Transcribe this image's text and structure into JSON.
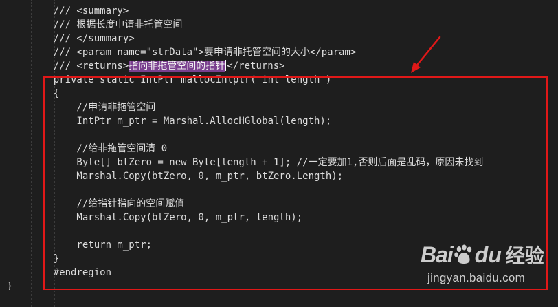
{
  "code": {
    "lines": [
      "    /// <summary>",
      "    /// 根据长度申请非托管空间",
      "    /// </summary>",
      "    /// <param name=\"strData\">要申请非托管空间的大小</param>",
      "    /// <returns>",
      "    private static IntPtr mallocIntptr( int length )",
      "    {",
      "        //申请非拖管空间",
      "        IntPtr m_ptr = Marshal.AllocHGlobal(length);",
      "",
      "        //给非拖管空间清 0",
      "        Byte[] btZero = new Byte[length + 1]; //一定要加1,否则后面是乱码，原因未找到",
      "        Marshal.Copy(btZero, 0, m_ptr, btZero.Length);",
      "",
      "        //给指针指向的空间赋值",
      "        Marshal.Copy(btZero, 0, m_ptr, length);",
      "",
      "        return m_ptr;",
      "    }",
      "    #endregion",
      "}"
    ],
    "selected_text": "指向非拖管空间的指针",
    "returns_close_tag": "</returns>"
  },
  "watermark": {
    "brand_bai": "Bai",
    "brand_du": "du",
    "brand_cn": "经验",
    "url": "jingyan.baidu.com"
  },
  "colors": {
    "background": "#1e1e1e",
    "text": "#dcdcdc",
    "selection": "#7a3f8f",
    "annotation": "#e01818"
  }
}
